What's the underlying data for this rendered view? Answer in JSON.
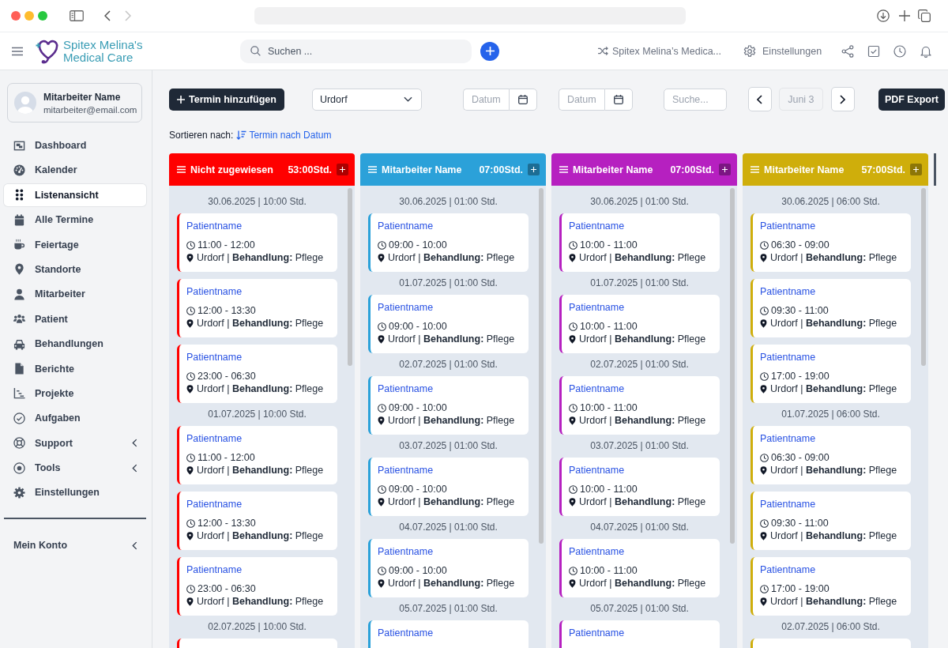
{
  "browser": {
    "can_go_forward": false
  },
  "header": {
    "logo_text": "Spitex Melina's Medical Care",
    "search": {
      "placeholder": "Suchen ..."
    },
    "workspace": "Spitex Melina’s Medica...",
    "settings": "Einstellungen"
  },
  "sidebar": {
    "user": {
      "name": "Mitarbeiter Name",
      "email": "mitarbeiter@email.com"
    },
    "items": [
      {
        "label": "Dashboard",
        "kind": "link",
        "selected": false
      },
      {
        "label": "Kalender",
        "kind": "link",
        "selected": false
      },
      {
        "label": "Listenansicht",
        "kind": "link",
        "selected": true
      },
      {
        "label": "Alle Termine",
        "kind": "link",
        "selected": false
      },
      {
        "label": "Feiertage",
        "kind": "link",
        "selected": false
      },
      {
        "label": "Standorte",
        "kind": "link",
        "selected": false
      },
      {
        "label": "Mitarbeiter",
        "kind": "link",
        "selected": false
      },
      {
        "label": "Patient",
        "kind": "link",
        "selected": false
      },
      {
        "label": "Behandlungen",
        "kind": "link",
        "selected": false
      },
      {
        "label": "Berichte",
        "kind": "link",
        "selected": false
      },
      {
        "label": "Projekte",
        "kind": "link",
        "selected": false
      },
      {
        "label": "Aufgaben",
        "kind": "link",
        "selected": false
      },
      {
        "label": "Support",
        "kind": "submenu",
        "selected": false
      },
      {
        "label": "Tools",
        "kind": "submenu",
        "selected": false
      },
      {
        "label": "Einstellungen",
        "kind": "link",
        "selected": false
      }
    ],
    "account": {
      "label": "Mein Konto",
      "kind": "submenu"
    }
  },
  "toolbar": {
    "add_button": "Termin hinzufügen",
    "location": "Urdorf",
    "date_from": {
      "placeholder": "Datum"
    },
    "date_to": {
      "placeholder": "Datum"
    },
    "search": {
      "placeholder": "Suche..."
    },
    "period": {
      "label": "Juni 3",
      "disabled": true
    },
    "export_button": "PDF Export"
  },
  "sort": {
    "label": "Sortieren nach:",
    "value": "Termin nach Datum"
  },
  "columns": [
    {
      "title": "Nicht zugewiesen",
      "hours": "53:00Std.",
      "color": "#ff0000",
      "groups": [
        {
          "date": "30.06.2025 | 10:00 Std.",
          "appointments": [
            {
              "kind": "full",
              "patient": "Patientname",
              "time": "11:00 - 12:00",
              "details": "Urdorf | **Behandlung:** Pflege"
            },
            {
              "kind": "full",
              "patient": "Patientname",
              "time": "12:00 - 13:30",
              "details": "Urdorf | **Behandlung:** Pflege"
            },
            {
              "kind": "full",
              "patient": "Patientname",
              "time": "23:00 - 06:30",
              "details": "Urdorf | **Behandlung:** Pflege"
            }
          ]
        },
        {
          "date": "01.07.2025 | 10:00 Std.",
          "appointments": [
            {
              "kind": "full",
              "patient": "Patientname",
              "time": "11:00 - 12:00",
              "details": "Urdorf | **Behandlung:** Pflege"
            },
            {
              "kind": "full",
              "patient": "Patientname",
              "time": "12:00 - 13:30",
              "details": "Urdorf | **Behandlung:** Pflege"
            },
            {
              "kind": "full",
              "patient": "Patientname",
              "time": "23:00 - 06:30",
              "details": "Urdorf | **Behandlung:** Pflege"
            }
          ]
        },
        {
          "date": "02.07.2025 | 10:00 Std.",
          "appointments": [
            {
              "kind": "stub"
            }
          ]
        }
      ]
    },
    {
      "title": "Mitarbeiter Name",
      "hours": "07:00Std.",
      "color": "#2ba1d9",
      "groups": [
        {
          "date": "30.06.2025 | 01:00 Std.",
          "appointments": [
            {
              "kind": "full",
              "patient": "Patientname",
              "time": "09:00 - 10:00",
              "details": "Urdorf | **Behandlung:** Pflege"
            }
          ]
        },
        {
          "date": "01.07.2025 | 01:00 Std.",
          "appointments": [
            {
              "kind": "full",
              "patient": "Patientname",
              "time": "09:00 - 10:00",
              "details": "Urdorf | **Behandlung:** Pflege"
            }
          ]
        },
        {
          "date": "02.07.2025 | 01:00 Std.",
          "appointments": [
            {
              "kind": "full",
              "patient": "Patientname",
              "time": "09:00 - 10:00",
              "details": "Urdorf | **Behandlung:** Pflege"
            }
          ]
        },
        {
          "date": "03.07.2025 | 01:00 Std.",
          "appointments": [
            {
              "kind": "full",
              "patient": "Patientname",
              "time": "09:00 - 10:00",
              "details": "Urdorf | **Behandlung:** Pflege"
            }
          ]
        },
        {
          "date": "04.07.2025 | 01:00 Std.",
          "appointments": [
            {
              "kind": "full",
              "patient": "Patientname",
              "time": "09:00 - 10:00",
              "details": "Urdorf | **Behandlung:** Pflege"
            }
          ]
        },
        {
          "date": "05.07.2025 | 01:00 Std.",
          "appointments": [
            {
              "kind": "name_only",
              "patient": "Patientname"
            }
          ]
        }
      ]
    },
    {
      "title": "Mitarbeiter Name",
      "hours": "07:00Std.",
      "color": "#b620c0",
      "groups": [
        {
          "date": "30.06.2025 | 01:00 Std.",
          "appointments": [
            {
              "kind": "full",
              "patient": "Patientname",
              "time": "10:00 - 11:00",
              "details": "Urdorf | **Behandlung:** Pflege"
            }
          ]
        },
        {
          "date": "01.07.2025 | 01:00 Std.",
          "appointments": [
            {
              "kind": "full",
              "patient": "Patientname",
              "time": "10:00 - 11:00",
              "details": "Urdorf | **Behandlung:** Pflege"
            }
          ]
        },
        {
          "date": "02.07.2025 | 01:00 Std.",
          "appointments": [
            {
              "kind": "full",
              "patient": "Patientname",
              "time": "10:00 - 11:00",
              "details": "Urdorf | **Behandlung:** Pflege"
            }
          ]
        },
        {
          "date": "03.07.2025 | 01:00 Std.",
          "appointments": [
            {
              "kind": "full",
              "patient": "Patientname",
              "time": "10:00 - 11:00",
              "details": "Urdorf | **Behandlung:** Pflege"
            }
          ]
        },
        {
          "date": "04.07.2025 | 01:00 Std.",
          "appointments": [
            {
              "kind": "full",
              "patient": "Patientname",
              "time": "10:00 - 11:00",
              "details": "Urdorf | **Behandlung:** Pflege"
            }
          ]
        },
        {
          "date": "05.07.2025 | 01:00 Std.",
          "appointments": [
            {
              "kind": "name_only",
              "patient": "Patientname"
            }
          ]
        }
      ]
    },
    {
      "title": "Mitarbeiter Name",
      "hours": "57:00Std.",
      "color": "#cfae0b",
      "groups": [
        {
          "date": "30.06.2025 | 06:00 Std.",
          "appointments": [
            {
              "kind": "full",
              "patient": "Patientname",
              "time": "06:30 - 09:00",
              "details": "Urdorf | **Behandlung:** Pflege"
            },
            {
              "kind": "full",
              "patient": "Patientname",
              "time": "09:30 - 11:00",
              "details": "Urdorf | **Behandlung:** Pflege"
            },
            {
              "kind": "full",
              "patient": "Patientname",
              "time": "17:00 - 19:00",
              "details": "Urdorf | **Behandlung:** Pflege"
            }
          ]
        },
        {
          "date": "01.07.2025 | 06:00 Std.",
          "appointments": [
            {
              "kind": "full",
              "patient": "Patientname",
              "time": "06:30 - 09:00",
              "details": "Urdorf | **Behandlung:** Pflege"
            },
            {
              "kind": "full",
              "patient": "Patientname",
              "time": "09:30 - 11:00",
              "details": "Urdorf | **Behandlung:** Pflege"
            },
            {
              "kind": "full",
              "patient": "Patientname",
              "time": "17:00 - 19:00",
              "details": "Urdorf | **Behandlung:** Pflege"
            }
          ]
        },
        {
          "date": "02.07.2025 | 06:00 Std.",
          "appointments": [
            {
              "kind": "stub"
            }
          ]
        }
      ]
    }
  ]
}
